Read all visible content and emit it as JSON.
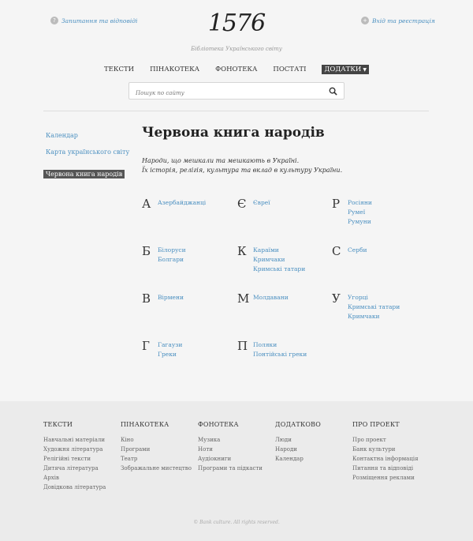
{
  "header": {
    "faq_link": "Запитання та відповіді",
    "faq_icon": "question-icon",
    "login_link": "Вхід та реєстрація",
    "login_icon": "plus-icon",
    "logo": "1576",
    "tagline": "Бібліотека Українського світу"
  },
  "nav": {
    "items": [
      "ТЕКСТИ",
      "ПІНАКОТЕКА",
      "ФОНОТЕКА",
      "ПОСТАТІ",
      "ДОДАТКИ"
    ],
    "active_index": 4
  },
  "search": {
    "placeholder": "Пошук по сайту"
  },
  "sidebar": {
    "items": [
      "Календар",
      "Карта українського світу",
      "Червона книга народів"
    ],
    "active_index": 2
  },
  "main": {
    "title": "Червона книга народів",
    "intro_line1": "Народи, що мешкали та мешкають в Україні.",
    "intro_line2": "Їх історія, релігія, культура та вклад в культуру України."
  },
  "groups": [
    {
      "letter": "А",
      "names": [
        "Азербайджанці"
      ]
    },
    {
      "letter": "Є",
      "names": [
        "Євреї"
      ]
    },
    {
      "letter": "Р",
      "names": [
        "Росіяни",
        "Румеї",
        "Румуни"
      ]
    },
    {
      "letter": "Б",
      "names": [
        "Білоруси",
        "Болгари"
      ]
    },
    {
      "letter": "К",
      "names": [
        "Караїми",
        "Кримчаки",
        "Кримські татари"
      ]
    },
    {
      "letter": "С",
      "names": [
        "Серби"
      ]
    },
    {
      "letter": "В",
      "names": [
        "Вірмени"
      ]
    },
    {
      "letter": "М",
      "names": [
        "Молдавани"
      ]
    },
    {
      "letter": "У",
      "names": [
        "Угорці",
        "Кримські татари",
        "Кримчаки"
      ]
    },
    {
      "letter": "Г",
      "names": [
        "Гагаузи",
        "Греки"
      ]
    },
    {
      "letter": "П",
      "names": [
        "Поляки",
        "Понтійські греки"
      ]
    }
  ],
  "footer": {
    "columns": [
      {
        "title": "ТЕКСТИ",
        "links": [
          "Навчальні матеріали",
          "Художня література",
          "Релігійні тексти",
          "Дитяча література",
          "Архів",
          "Довідкова література"
        ]
      },
      {
        "title": "ПІНАКОТЕКА",
        "links": [
          "Кіно",
          "Програми",
          "Театр",
          "Зображальне мистецтво"
        ]
      },
      {
        "title": "ФОНОТЕКА",
        "links": [
          "Музика",
          "Ноти",
          "Аудіокниги",
          "Програми та підкасти"
        ]
      },
      {
        "title": "ДОДАТКОВО",
        "links": [
          "Люди",
          "Народи",
          "Календар"
        ]
      },
      {
        "title": "ПРО ПРОЕКТ",
        "links": [
          "Про проект",
          "Банк культури",
          "Контактна інформація",
          "Питання та відповіді",
          "Розміщення реклами"
        ]
      }
    ],
    "copyright": "© Bank culture. All rights reserved."
  },
  "colors": {
    "link": "#4a8fc0",
    "active_bg": "#444444",
    "background": "#f5f5f5",
    "footer_bg": "#ebebeb"
  }
}
